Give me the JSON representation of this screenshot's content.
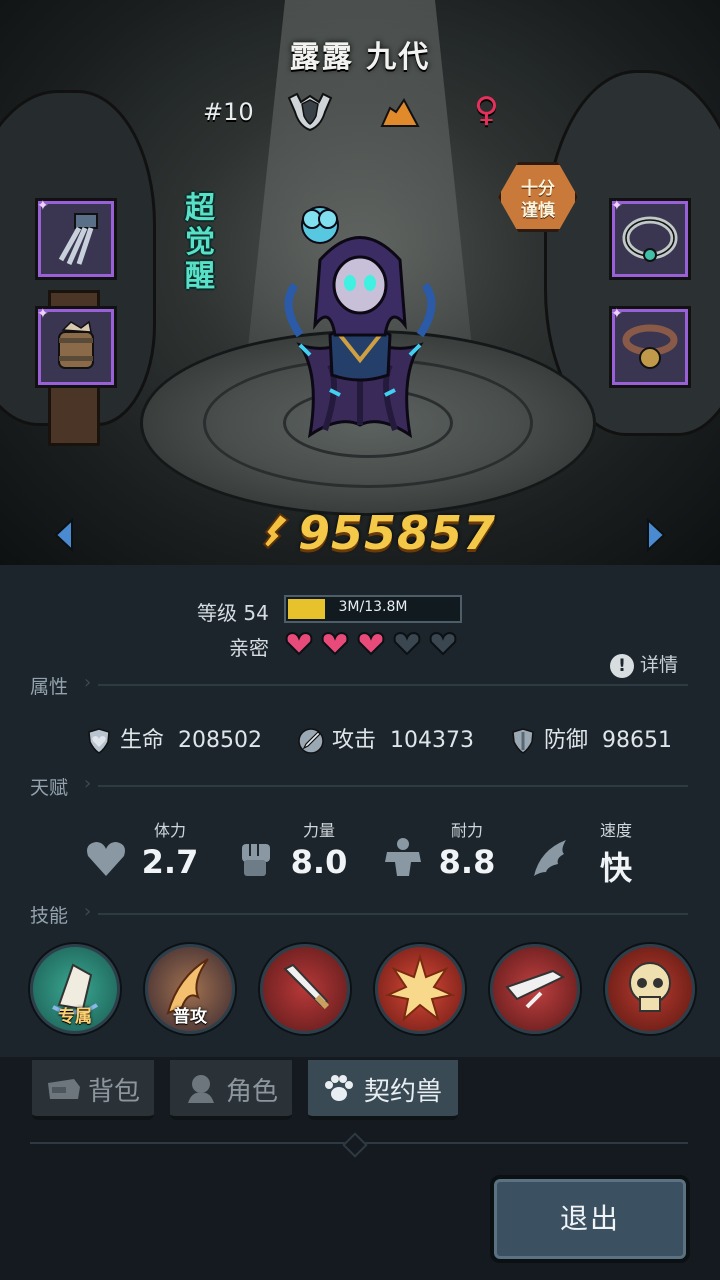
{
  "hero": {
    "name": "露露 九代",
    "rank": "#10",
    "awaken_label": "超觉醒",
    "trait_line1": "十分",
    "trait_line2": "谨慎",
    "power": "955857"
  },
  "level": {
    "label": "等级 54",
    "xp_text": "3M/13.8M",
    "xp_fraction": 0.22
  },
  "intimacy": {
    "label": "亲密",
    "filled": 3,
    "total": 5
  },
  "detail_label": "详情",
  "sections": {
    "attributes": "属性",
    "talents": "天赋",
    "skills": "技能"
  },
  "attributes": [
    {
      "label": "生命",
      "value": "208502",
      "icon": "heart-shield-icon"
    },
    {
      "label": "攻击",
      "value": "104373",
      "icon": "sword-icon"
    },
    {
      "label": "防御",
      "value": "98651",
      "icon": "shield-icon"
    }
  ],
  "talents": [
    {
      "label": "体力",
      "value": "2.7",
      "icon": "heart-icon"
    },
    {
      "label": "力量",
      "value": "8.0",
      "icon": "fist-icon"
    },
    {
      "label": "耐力",
      "value": "8.8",
      "icon": "muscle-icon"
    },
    {
      "label": "速度",
      "value": "快",
      "icon": "wing-icon"
    }
  ],
  "skills": [
    {
      "tag": "专属",
      "icon": "exclusive-skill-icon"
    },
    {
      "tag": "普攻",
      "icon": "basic-attack-icon"
    },
    {
      "tag": "",
      "icon": "sword-strike-icon"
    },
    {
      "tag": "",
      "icon": "explosion-icon"
    },
    {
      "tag": "",
      "icon": "blade-slash-icon"
    },
    {
      "tag": "",
      "icon": "skull-icon"
    }
  ],
  "tabs": [
    {
      "label": "背包",
      "icon": "bag-icon",
      "active": false
    },
    {
      "label": "角色",
      "icon": "person-icon",
      "active": false
    },
    {
      "label": "契约兽",
      "icon": "paw-icon",
      "active": true
    }
  ],
  "exit_label": "退出",
  "colors": {
    "power": "#f4c848",
    "awaken": "#58e0c8",
    "heart_filled": "#e84a7a",
    "heart_empty": "#3a4650",
    "xp_fill": "#e8c22c",
    "equip_border": "#9a60d8"
  }
}
